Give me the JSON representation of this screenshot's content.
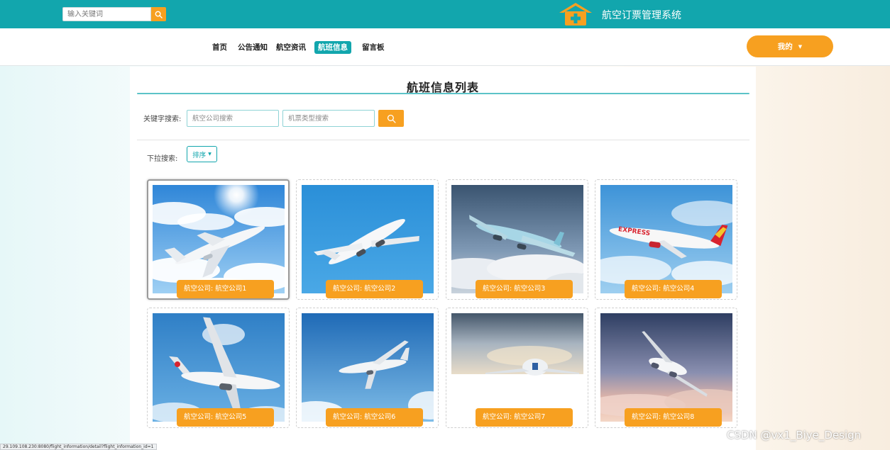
{
  "header": {
    "search_placeholder": "输入关键词",
    "app_title": "航空订票管理系统"
  },
  "nav": {
    "items": [
      "首页",
      "公告通知",
      "航空资讯",
      "航班信息",
      "留言板"
    ],
    "active_index": 3,
    "me_label": "我的"
  },
  "page": {
    "title": "航班信息列表",
    "keyword_label": "关键字搜索:",
    "airline_placeholder": "航空公司搜索",
    "aircraft_placeholder": "机票类型搜索",
    "dropdown_label": "下拉搜索:",
    "sort_label": "排序"
  },
  "cards": [
    {
      "caption": "航空公司: 航空公司1"
    },
    {
      "caption": "航空公司: 航空公司2"
    },
    {
      "caption": "航空公司: 航空公司3"
    },
    {
      "caption": "航空公司: 航空公司4"
    },
    {
      "caption": "航空公司: 航空公司5"
    },
    {
      "caption": "航空公司: 航空公司6"
    },
    {
      "caption": "航空公司: 航空公司7"
    },
    {
      "caption": "航空公司: 航空公司8"
    }
  ],
  "status_url": "29.109.108.230:8080/flight_information/detail?flight_information_id=1",
  "watermark": "CSDN @vx1_Biye_Design",
  "colors": {
    "primary": "#12a6ad",
    "accent": "#f7a020"
  }
}
